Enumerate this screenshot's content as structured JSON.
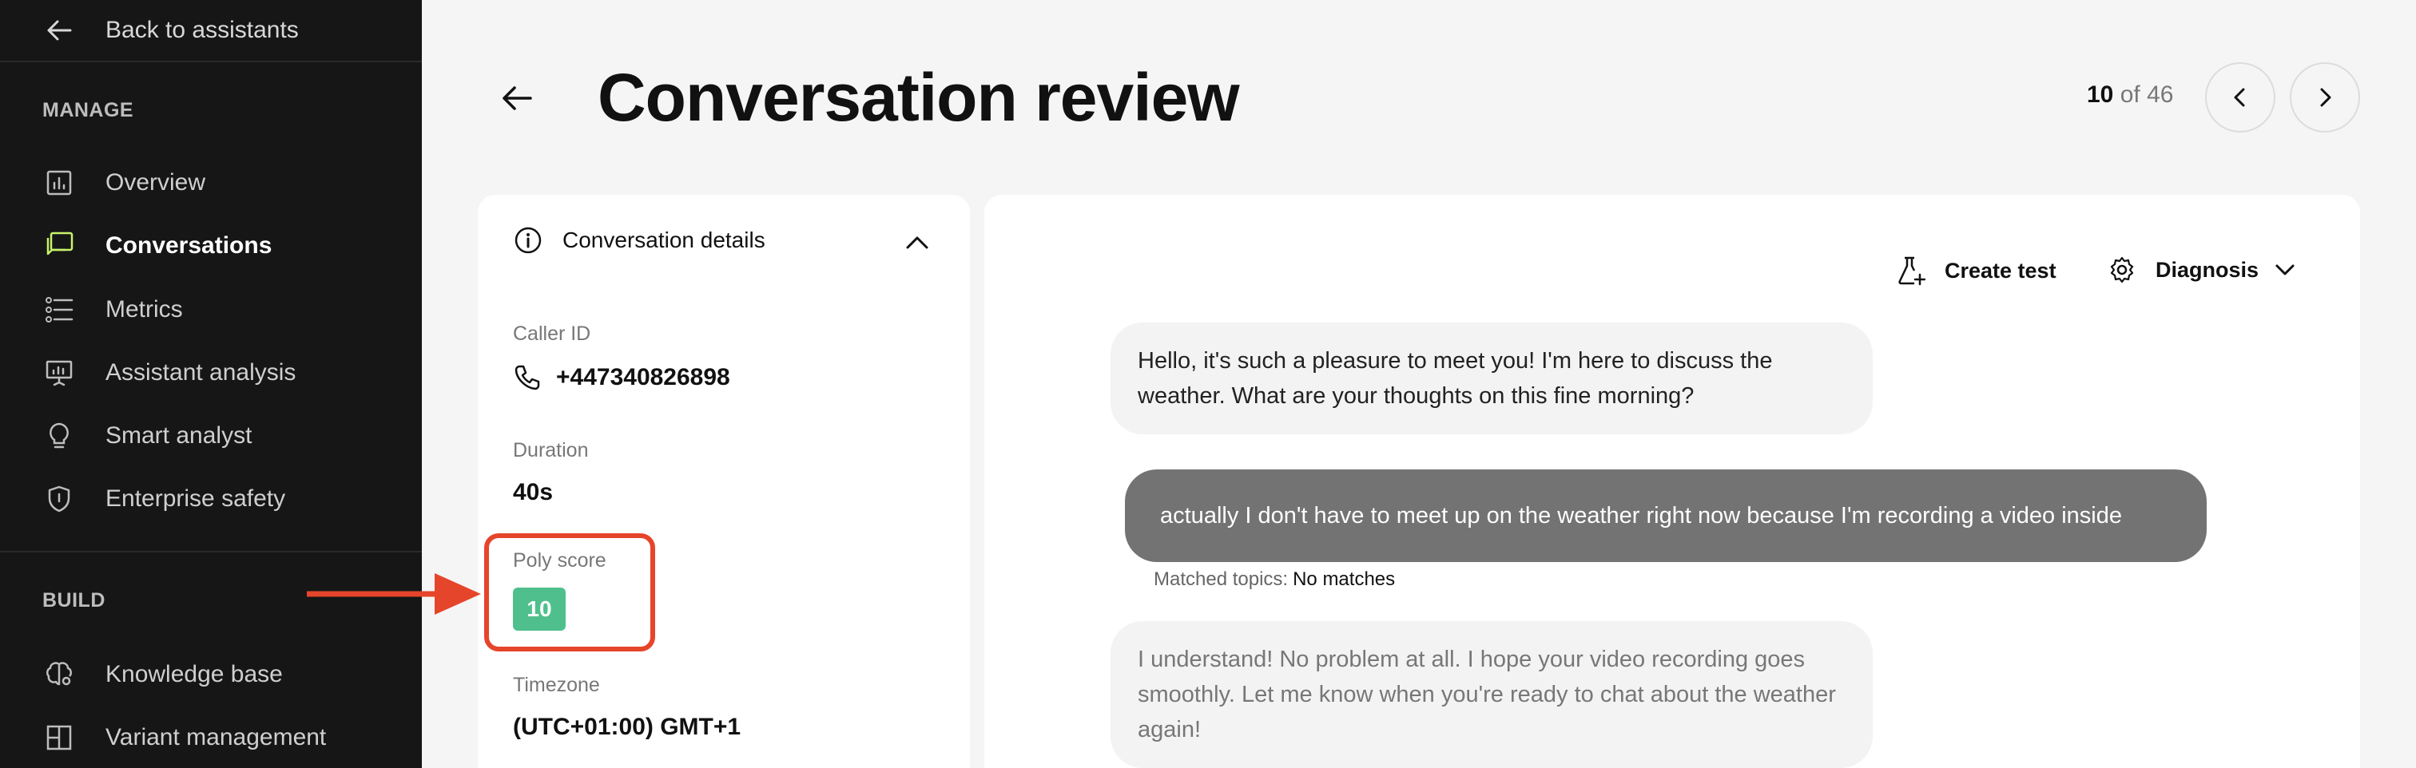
{
  "sidebar": {
    "back_label": "Back to assistants",
    "manage_label": "MANAGE",
    "manage_items": [
      {
        "label": "Overview",
        "icon": "chart-icon"
      },
      {
        "label": "Conversations",
        "icon": "chat-icon",
        "active": true
      },
      {
        "label": "Metrics",
        "icon": "list-icon"
      },
      {
        "label": "Assistant analysis",
        "icon": "presentation-icon"
      },
      {
        "label": "Smart analyst",
        "icon": "lightbulb-icon"
      },
      {
        "label": "Enterprise safety",
        "icon": "shield-icon"
      }
    ],
    "build_label": "BUILD",
    "build_items": [
      {
        "label": "Knowledge base",
        "icon": "brain-icon"
      },
      {
        "label": "Variant management",
        "icon": "grid-icon"
      }
    ]
  },
  "header": {
    "title": "Conversation review",
    "pager_current": "10",
    "pager_of": "of 46"
  },
  "details": {
    "heading": "Conversation details",
    "caller_id_label": "Caller ID",
    "caller_id": "+447340826898",
    "duration_label": "Duration",
    "duration": "40s",
    "poly_score_label": "Poly score",
    "poly_score": "10",
    "timezone_label": "Timezone",
    "timezone": "(UTC+01:00) GMT+1"
  },
  "conversation": {
    "create_test_label": "Create test",
    "diagnosis_label": "Diagnosis",
    "messages": [
      {
        "role": "assistant",
        "text": "Hello, it's such a pleasure to meet you! I'm here to discuss the weather. What are your thoughts on this fine morning?"
      },
      {
        "role": "user",
        "text": "actually I don't have to meet up on the weather right now because I'm recording a video inside"
      },
      {
        "role": "assistant",
        "text": "I understand! No problem at all. I hope your video recording goes smoothly. Let me know when you're ready to chat about the weather again!"
      }
    ],
    "matched_topics_label": "Matched topics:",
    "matched_topics_value": "No matches"
  },
  "colors": {
    "sidebar_bg": "#161616",
    "active_icon": "#c8f26a",
    "score_badge": "#4fc08d",
    "annotation_red": "#e5452a",
    "user_bubble": "#737373"
  }
}
